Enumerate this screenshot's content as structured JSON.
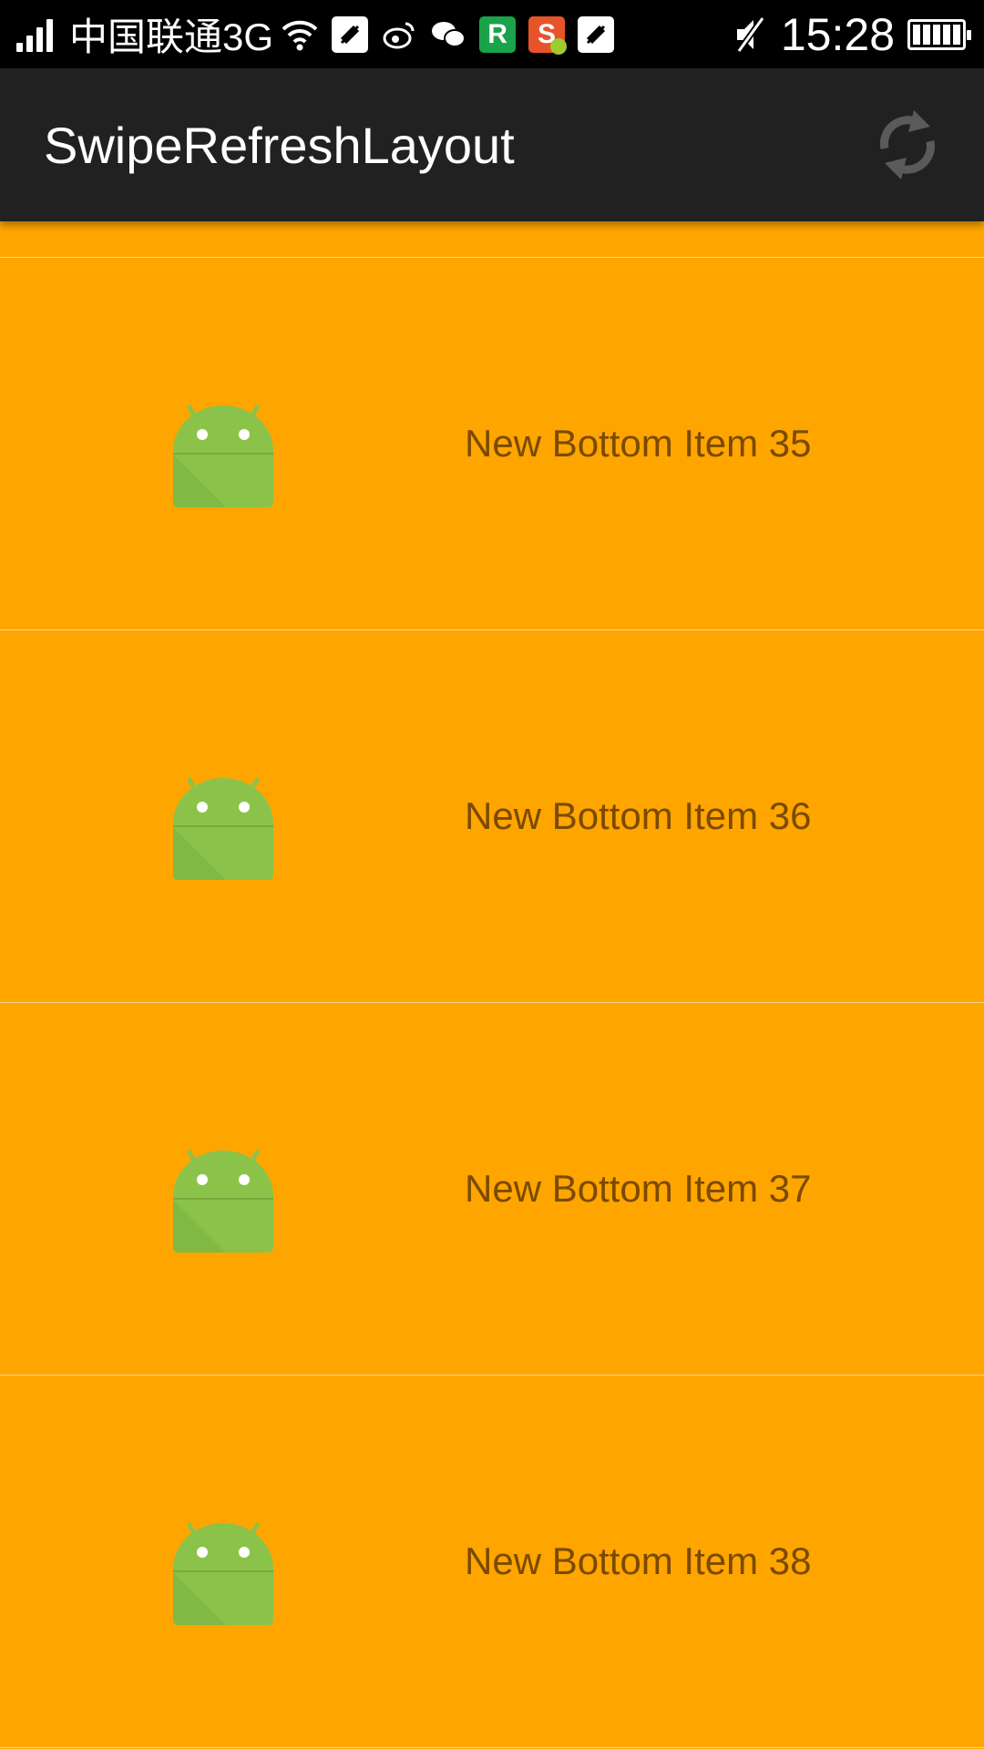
{
  "status_bar": {
    "carrier": "中国联通3G",
    "time": "15:28",
    "icons": [
      "signal-icon",
      "wifi-icon",
      "notification-app-icon",
      "weibo-icon",
      "wechat-icon",
      "r-app-icon",
      "sogou-icon",
      "notification-app-icon",
      "mute-icon",
      "battery-icon"
    ]
  },
  "app_bar": {
    "title": "SwipeRefreshLayout",
    "action_icon": "refresh-icon"
  },
  "list": {
    "items": [
      {
        "label": "New Bottom Item 35",
        "icon": "android-icon"
      },
      {
        "label": "New Bottom Item 36",
        "icon": "android-icon"
      },
      {
        "label": "New Bottom Item 37",
        "icon": "android-icon"
      },
      {
        "label": "New Bottom Item 38",
        "icon": "android-icon"
      }
    ]
  },
  "colors": {
    "list_background": "#FFA500",
    "app_bar": "#212121",
    "status_bar": "#000000",
    "item_text": "#7A4A00",
    "android_green": "#8BC34A"
  }
}
